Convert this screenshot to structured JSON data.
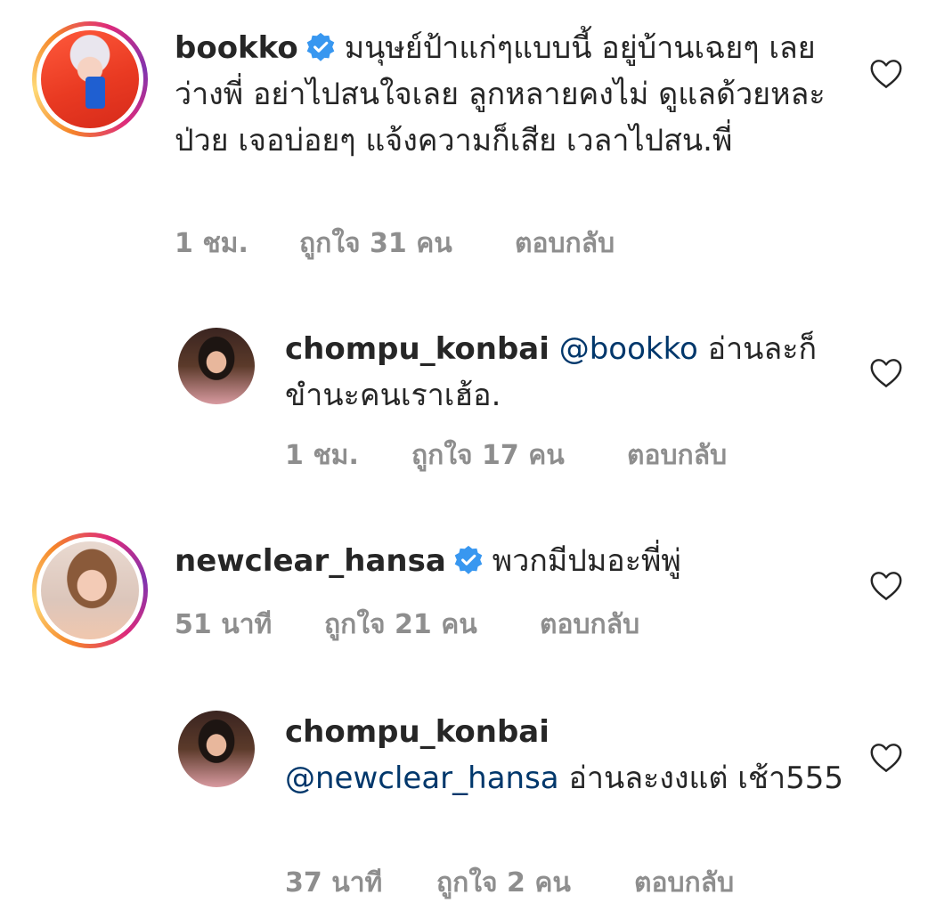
{
  "comments": [
    {
      "username": "bookko",
      "verified": true,
      "text": "มนุษย์ป้าแก่ๆแบบนี้ อยู่บ้านเฉยๆ เลยว่างพี่ อย่าไปสนใจเลย ลูกหลายคงไม่ ดูแลด้วยหละ ป่วย เจอบ่อยๆ แจ้งความก็เสีย เวลาไปสน.พี่",
      "time": "1 ชม.",
      "likes": "ถูกใจ 31 คน",
      "reply": "ตอบกลับ"
    },
    {
      "username": "chompu_konbai",
      "mention": "@bookko",
      "text": "อ่านละก็ ขำนะคนเราเฮ้อ.",
      "time": "1 ชม.",
      "likes": "ถูกใจ 17 คน",
      "reply": "ตอบกลับ"
    },
    {
      "username": "newclear_hansa",
      "verified": true,
      "text": "พวกมีปมอะพี่พู่",
      "time": "51 นาที",
      "likes": "ถูกใจ 21 คน",
      "reply": "ตอบกลับ"
    },
    {
      "username": "chompu_konbai",
      "mention": "@newclear_hansa",
      "text": "อ่านละงงแต่ เช้า555",
      "time": "37 นาที",
      "likes": "ถูกใจ 2 คน",
      "reply": "ตอบกลับ"
    }
  ],
  "icons": {
    "verified": "verified-badge-icon",
    "like": "heart-outline-icon"
  },
  "colors": {
    "text": "#262626",
    "meta": "#8e8e8e",
    "mention": "#00376b",
    "verified": "#3897f0"
  }
}
